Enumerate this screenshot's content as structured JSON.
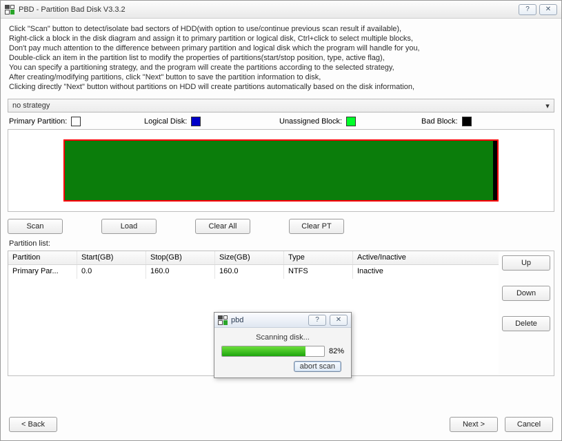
{
  "window": {
    "title": "PBD - Partition Bad Disk V3.3.2"
  },
  "instructions": [
    "Click \"Scan\" button to detect/isolate bad sectors of HDD(with option to use/continue previous scan result if available),",
    "Right-click a block in the disk diagram and assign it to primary partition or logical disk, Ctrl+click to select multiple blocks,",
    "Don't pay much attention to the difference between primary partition and logical disk which the program will handle for you,",
    "Double-click an item in the partition list to modify the properties of partitions(start/stop position, type, active flag),",
    "You can specify a partitioning strategy, and the program will create the partitions according to the selected strategy,",
    "After creating/modifying partitions, click \"Next\" button to save the partition information to disk,",
    "Clicking directly \"Next\" button without partitions on HDD will create partitions automatically based on the disk information,"
  ],
  "strategy": {
    "selected": "no strategy"
  },
  "legend": {
    "primary": {
      "label": "Primary Partition:",
      "color": "#0b7d0b"
    },
    "logical": {
      "label": "Logical Disk:",
      "color": "#0000c8"
    },
    "unassigned": {
      "label": "Unassigned Block:",
      "color": "#00ff2a"
    },
    "bad": {
      "label": "Bad Block:",
      "color": "#000000"
    }
  },
  "buttons": {
    "scan": "Scan",
    "load": "Load",
    "clear_all": "Clear All",
    "clear_pt": "Clear PT",
    "up": "Up",
    "down": "Down",
    "delete": "Delete",
    "back": "< Back",
    "next": "Next >",
    "cancel": "Cancel"
  },
  "partition_list_label": "Partition list:",
  "table": {
    "headers": {
      "partition": "Partition",
      "start": "Start(GB)",
      "stop": "Stop(GB)",
      "size": "Size(GB)",
      "type": "Type",
      "active": "Active/Inactive"
    },
    "rows": [
      {
        "partition": "Primary Par...",
        "start": "0.0",
        "stop": "160.0",
        "size": "160.0",
        "type": "NTFS",
        "active": "Inactive"
      }
    ]
  },
  "modal": {
    "title": "pbd",
    "status": "Scanning disk...",
    "percent": "82%",
    "abort": "abort scan"
  },
  "icons": {
    "help": "?",
    "close": "✕",
    "dropdown": "▾"
  }
}
